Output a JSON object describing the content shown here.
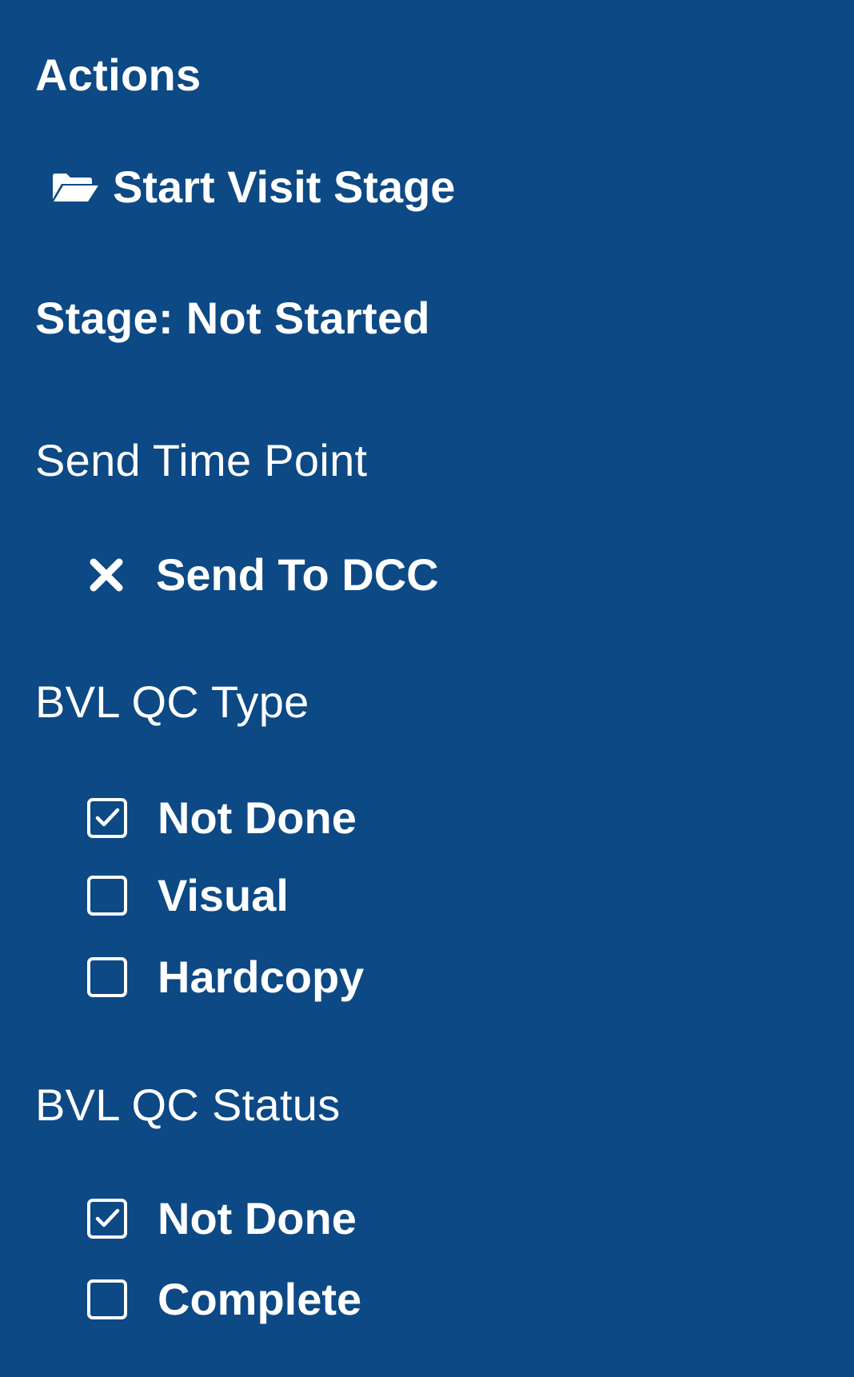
{
  "colors": {
    "panel_background": "#0d4984",
    "text": "#ffffff"
  },
  "actions": {
    "title": "Actions",
    "start_visit_stage": {
      "icon": "folder-open-icon",
      "label": "Start Visit Stage"
    }
  },
  "stage": {
    "text": "Stage: Not Started"
  },
  "send_time_point": {
    "title": "Send Time Point",
    "send_to_dcc": {
      "icon": "close-icon",
      "label": "Send To DCC"
    }
  },
  "bvl_qc_type": {
    "title": "BVL QC Type",
    "options": [
      {
        "label": "Not Done",
        "checked": true
      },
      {
        "label": "Visual",
        "checked": false
      },
      {
        "label": "Hardcopy",
        "checked": false
      }
    ]
  },
  "bvl_qc_status": {
    "title": "BVL QC Status",
    "options": [
      {
        "label": "Not Done",
        "checked": true
      },
      {
        "label": "Complete",
        "checked": false
      }
    ]
  }
}
